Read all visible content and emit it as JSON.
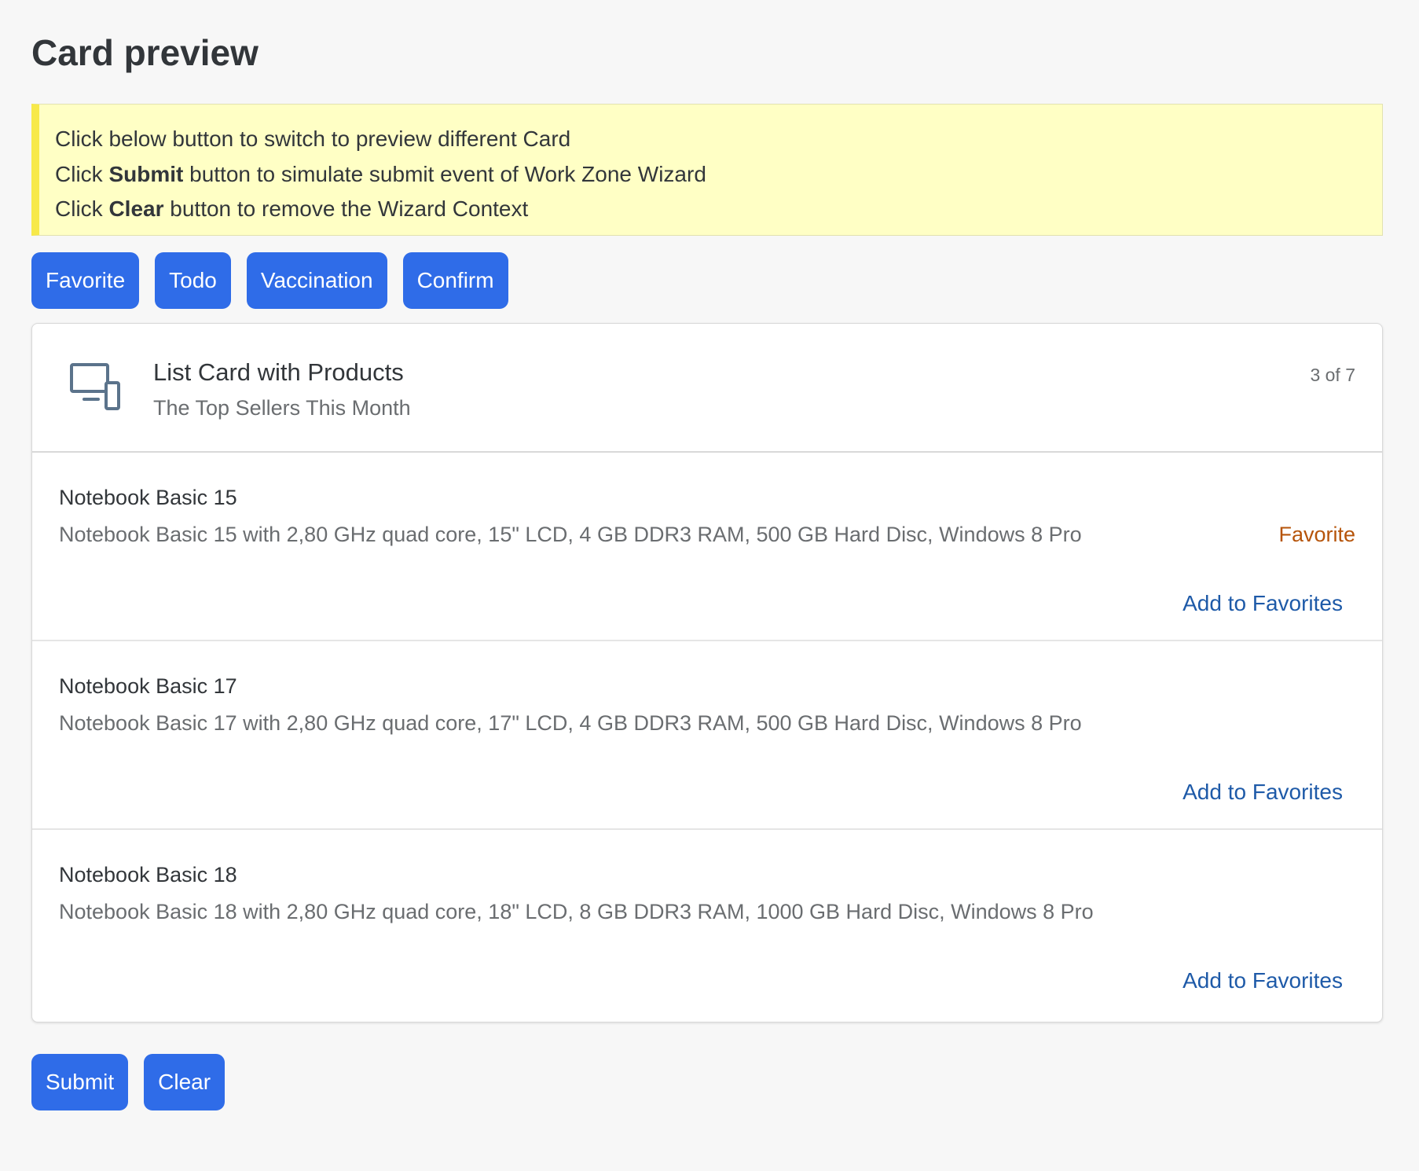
{
  "page": {
    "title": "Card preview"
  },
  "info": {
    "line1": "Click below button to switch to preview different Card",
    "line2_prefix": "Click ",
    "line2_bold": "Submit",
    "line2_suffix": " button to simulate submit event of Work Zone Wizard",
    "line3_prefix": "Click ",
    "line3_bold": "Clear",
    "line3_suffix": " button to remove the Wizard Context"
  },
  "card_buttons": {
    "favorite": "Favorite",
    "todo": "Todo",
    "vaccination": "Vaccination",
    "confirm": "Confirm"
  },
  "card": {
    "icon": "devices-icon",
    "title": "List Card with Products",
    "subtitle": "The Top Sellers This Month",
    "counter": "3 of 7",
    "items": [
      {
        "title": "Notebook Basic 15",
        "description": "Notebook Basic 15 with 2,80 GHz quad core, 15\" LCD, 4 GB DDR3 RAM, 500 GB Hard Disc, Windows 8 Pro",
        "status": "Favorite",
        "action": "Add to Favorites"
      },
      {
        "title": "Notebook Basic 17",
        "description": "Notebook Basic 17 with 2,80 GHz quad core, 17\" LCD, 4 GB DDR3 RAM, 500 GB Hard Disc, Windows 8 Pro",
        "status": "",
        "action": "Add to Favorites"
      },
      {
        "title": "Notebook Basic 18",
        "description": "Notebook Basic 18 with 2,80 GHz quad core, 18\" LCD, 8 GB DDR3 RAM, 1000 GB Hard Disc, Windows 8 Pro",
        "status": "",
        "action": "Add to Favorites"
      }
    ]
  },
  "bottom_buttons": {
    "submit": "Submit",
    "clear": "Clear"
  },
  "colors": {
    "button": "#2f6ce8",
    "info_background": "#ffffc5",
    "info_accent": "#f7e94a",
    "status_favorite": "#b6540a",
    "link": "#1e5aa8"
  }
}
